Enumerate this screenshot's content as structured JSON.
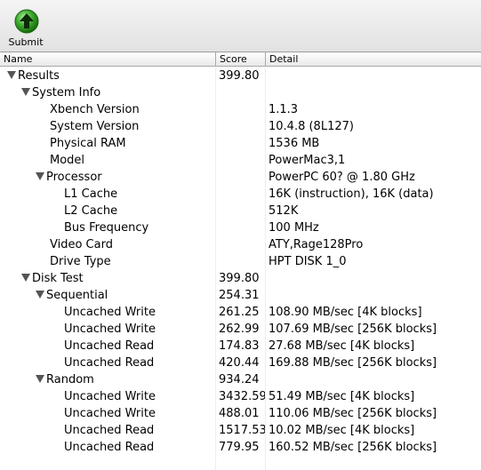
{
  "toolbar": {
    "submit_label": "Submit"
  },
  "columns": {
    "name": "Name",
    "score": "Score",
    "detail": "Detail"
  },
  "rows": [
    {
      "level": 0,
      "expander": true,
      "name": "Results",
      "score": "399.80",
      "detail": ""
    },
    {
      "level": 1,
      "expander": true,
      "name": "System Info",
      "score": "",
      "detail": ""
    },
    {
      "level": 2,
      "expander": false,
      "name": "Xbench Version",
      "score": "",
      "detail": "1.1.3"
    },
    {
      "level": 2,
      "expander": false,
      "name": "System Version",
      "score": "",
      "detail": "10.4.8 (8L127)"
    },
    {
      "level": 2,
      "expander": false,
      "name": "Physical RAM",
      "score": "",
      "detail": "1536 MB"
    },
    {
      "level": 2,
      "expander": false,
      "name": "Model",
      "score": "",
      "detail": "PowerMac3,1"
    },
    {
      "level": 2,
      "expander": true,
      "name": "Processor",
      "score": "",
      "detail": "PowerPC 60? @ 1.80 GHz"
    },
    {
      "level": 3,
      "expander": false,
      "name": "L1 Cache",
      "score": "",
      "detail": "16K (instruction), 16K (data)"
    },
    {
      "level": 3,
      "expander": false,
      "name": "L2 Cache",
      "score": "",
      "detail": "512K"
    },
    {
      "level": 3,
      "expander": false,
      "name": "Bus Frequency",
      "score": "",
      "detail": "100 MHz"
    },
    {
      "level": 2,
      "expander": false,
      "name": "Video Card",
      "score": "",
      "detail": "ATY,Rage128Pro"
    },
    {
      "level": 2,
      "expander": false,
      "name": "Drive Type",
      "score": "",
      "detail": "HPT DISK 1_0"
    },
    {
      "level": 1,
      "expander": true,
      "name": "Disk Test",
      "score": "399.80",
      "detail": ""
    },
    {
      "level": 2,
      "expander": true,
      "name": "Sequential",
      "score": "254.31",
      "detail": ""
    },
    {
      "level": 3,
      "expander": false,
      "name": "Uncached Write",
      "score": "261.25",
      "detail": "108.90 MB/sec [4K blocks]"
    },
    {
      "level": 3,
      "expander": false,
      "name": "Uncached Write",
      "score": "262.99",
      "detail": "107.69 MB/sec [256K blocks]"
    },
    {
      "level": 3,
      "expander": false,
      "name": "Uncached Read",
      "score": "174.83",
      "detail": "27.68 MB/sec [4K blocks]"
    },
    {
      "level": 3,
      "expander": false,
      "name": "Uncached Read",
      "score": "420.44",
      "detail": "169.88 MB/sec [256K blocks]"
    },
    {
      "level": 2,
      "expander": true,
      "name": "Random",
      "score": "934.24",
      "detail": ""
    },
    {
      "level": 3,
      "expander": false,
      "name": "Uncached Write",
      "score": "3432.59",
      "detail": "51.49 MB/sec [4K blocks]"
    },
    {
      "level": 3,
      "expander": false,
      "name": "Uncached Write",
      "score": "488.01",
      "detail": "110.06 MB/sec [256K blocks]"
    },
    {
      "level": 3,
      "expander": false,
      "name": "Uncached Read",
      "score": "1517.53",
      "detail": "10.02 MB/sec [4K blocks]"
    },
    {
      "level": 3,
      "expander": false,
      "name": "Uncached Read",
      "score": "779.95",
      "detail": "160.52 MB/sec [256K blocks]"
    }
  ]
}
